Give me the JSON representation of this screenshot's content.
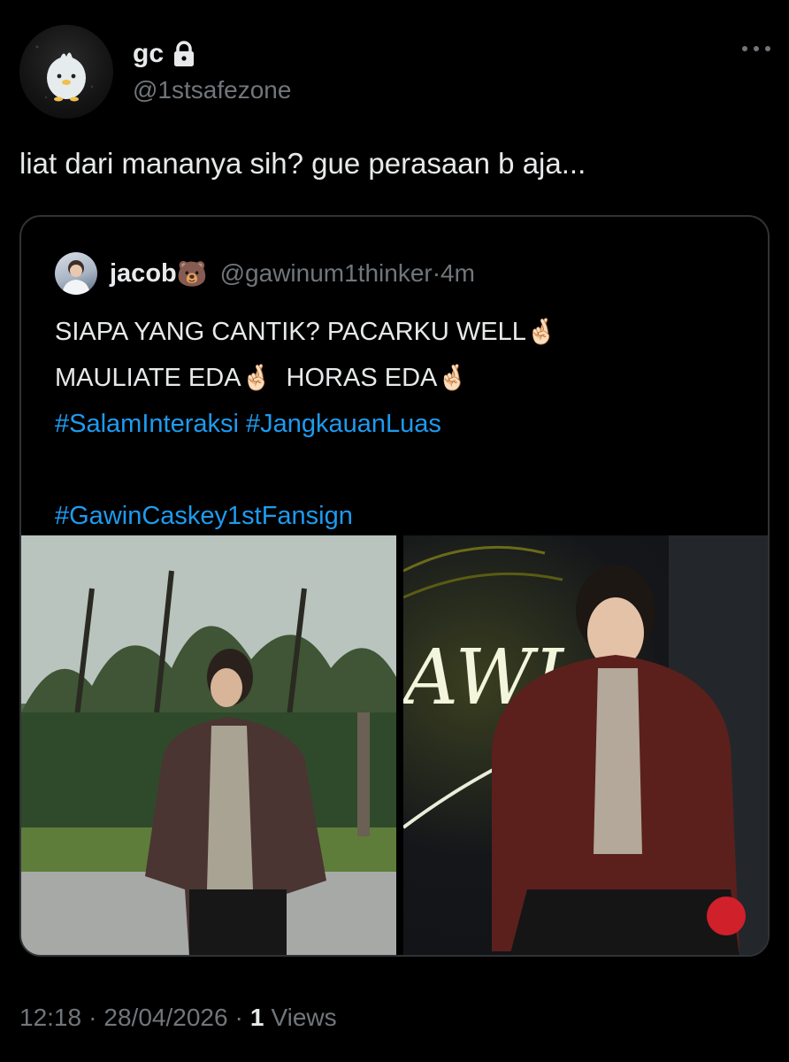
{
  "author": {
    "display_name": "gc",
    "handle": "@1stsafezone",
    "protected_icon": "lock-icon",
    "avatar_icon": "ghost-chick-avatar"
  },
  "more_icon": "more-horizontal-icon",
  "tweet": {
    "text": "liat dari mananya sih? gue perasaan b aja..."
  },
  "quoted_tweet": {
    "display_name": "jacob",
    "name_emoji": "🐻",
    "handle": "@gawinum1thinker",
    "separator": " · ",
    "time": "4m",
    "line1_text": "SIAPA YANG CANTIK? PACARKU WELL",
    "line1_emoji": "🤞🏻",
    "line2_a": "MAULIATE EDA",
    "line2_emoji_a": "🤞🏻",
    "line2_b": "  HORAS EDA",
    "line2_emoji_b": "🤞🏻",
    "hashtags_line1": "#SalamInteraksi #JangkauanLuas",
    "hashtag_line2": "#GawinCaskey1stFansign",
    "media": [
      {
        "name": "photo-outdoor-leather-jacket"
      },
      {
        "name": "photo-event-stage-leather-jacket"
      }
    ]
  },
  "meta": {
    "time": "12:18",
    "dot1": "·",
    "date": "28/04/2026",
    "dot2": "·",
    "views_count": "1",
    "views_label": "Views"
  },
  "colors": {
    "background": "#000000",
    "text": "#e7e9ea",
    "secondary": "#71767b",
    "link": "#1d9bf0",
    "border": "#2f3336"
  }
}
